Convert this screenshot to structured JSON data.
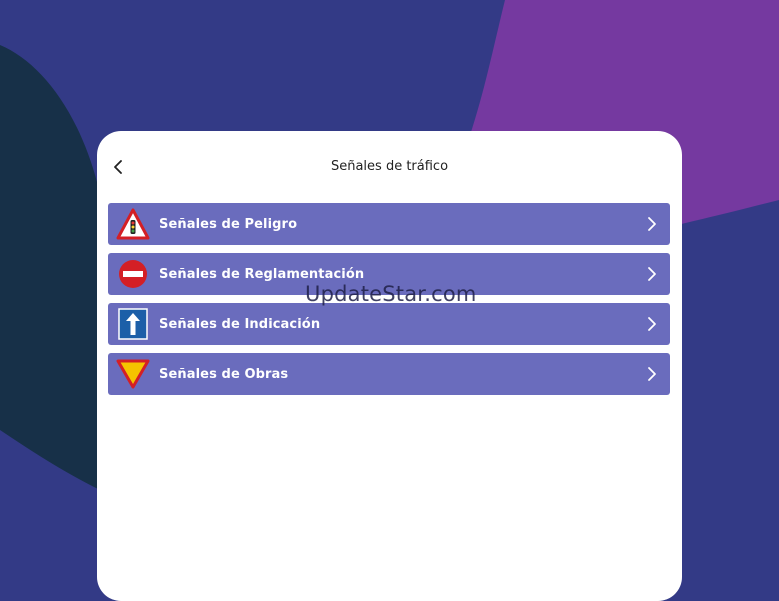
{
  "header": {
    "title": "Señales de tráfico",
    "back_icon": "chevron-left-icon"
  },
  "categories": [
    {
      "label": "Señales de Peligro",
      "icon": "warning-triangle-sign-icon"
    },
    {
      "label": "Señales de Reglamentación",
      "icon": "no-entry-sign-icon"
    },
    {
      "label": "Señales de Indicación",
      "icon": "one-way-arrow-sign-icon"
    },
    {
      "label": "Señales de Obras",
      "icon": "yield-triangle-sign-icon"
    }
  ],
  "watermark": "UpdateStar.com",
  "colors": {
    "background": "#333a86",
    "accent_purple": "#7539a0",
    "dark_blob": "#173048",
    "list_item": "#6a6cbd",
    "card": "#ffffff"
  }
}
